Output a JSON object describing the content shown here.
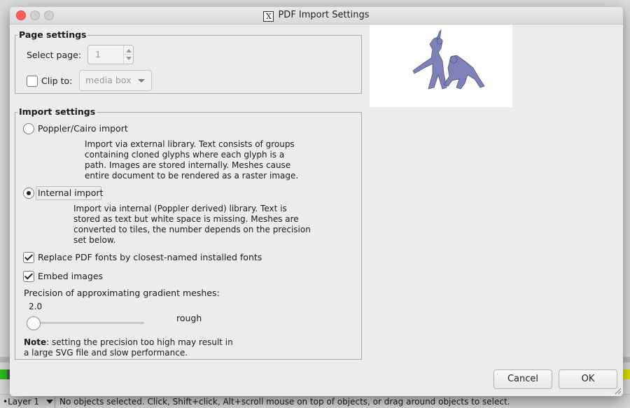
{
  "dialog": {
    "title": "PDF Import Settings",
    "title_icon_glyph": "X"
  },
  "page_settings": {
    "legend": "Page settings",
    "select_page_label": "Select page:",
    "select_page_value": "1",
    "clip_to_label": "Clip to:",
    "clip_to_checked": false,
    "clip_to_value": "media box"
  },
  "import_settings": {
    "legend": "Import settings",
    "poppler": {
      "label": "Poppler/Cairo import",
      "selected": false,
      "description": [
        "Import via external library. Text consists of groups",
        "containing cloned glyphs where each glyph is a",
        "path. Images are stored internally. Meshes cause",
        "entire document to be rendered as a raster image."
      ]
    },
    "internal": {
      "label": "Internal import",
      "selected": true,
      "description": [
        "Import via internal (Poppler derived) library. Text is",
        "stored as text but white space is missing. Meshes are",
        "converted to tiles, the number depends on the precision",
        "set below."
      ]
    },
    "replace_fonts": {
      "label": "Replace PDF fonts by closest-named installed fonts",
      "checked": true
    },
    "embed_images": {
      "label": "Embed images",
      "checked": true
    },
    "precision": {
      "label": "Precision of approximating gradient meshes:",
      "value": "2.0",
      "slider_fraction": 0.0,
      "quality_label": "rough"
    },
    "note": {
      "bold": "Note",
      "line1": ": setting the precision too high may result in",
      "line2": "a large SVG file and slow performance."
    }
  },
  "buttons": {
    "cancel": "Cancel",
    "ok": "OK"
  },
  "status_bar": {
    "layer": "•Layer 1",
    "message": "No objects selected. Click, Shift+click, Alt+scroll mouse on top of objects, or drag around objects to select."
  },
  "colors": {
    "preview_figures": "#7f82b8",
    "close_button": "#fc5f57",
    "bg_green": "#2cc21a",
    "bg_yellow": "#e3e600"
  }
}
